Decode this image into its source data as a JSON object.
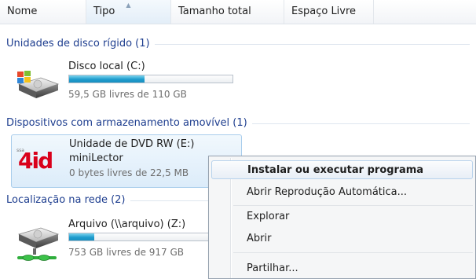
{
  "columns": [
    {
      "label": "Nome"
    },
    {
      "label": "Tipo",
      "sorted": true
    },
    {
      "label": "Tamanho total"
    },
    {
      "label": "Espaço Livre"
    }
  ],
  "groups": {
    "hard_disks": "Unidades de disco rígido (1)",
    "removable": "Dispositivos com armazenamento amovível (1)",
    "network": "Localização na rede (2)"
  },
  "drives": {
    "local_c": {
      "name": "Disco local (C:)",
      "free_text": "59,5 GB livres de 110 GB",
      "used_fraction": 0.46
    },
    "dvd_e": {
      "name": "Unidade de DVD RW (E:)",
      "label": "miniLector",
      "free_text": "0 bytes livres de 22,5 MB",
      "logo_text": "4id",
      "logo_small": "ssa"
    },
    "arquivo_z": {
      "name": "Arquivo (\\\\arquivo) (Z:)",
      "free_text": "753 GB livres de 917 GB",
      "used_fraction": 0.18
    }
  },
  "context_menu": {
    "items": [
      {
        "label": "Instalar ou executar programa",
        "default": true
      },
      {
        "label": "Abrir Reprodução Automática..."
      },
      {
        "label": "Explorar"
      },
      {
        "label": "Abrir"
      },
      {
        "label": "Partilhar..."
      }
    ]
  },
  "colors": {
    "group_header": "#1e3e8f",
    "bar_fill": "#1e9ccd",
    "logo_red": "#d9001b"
  }
}
